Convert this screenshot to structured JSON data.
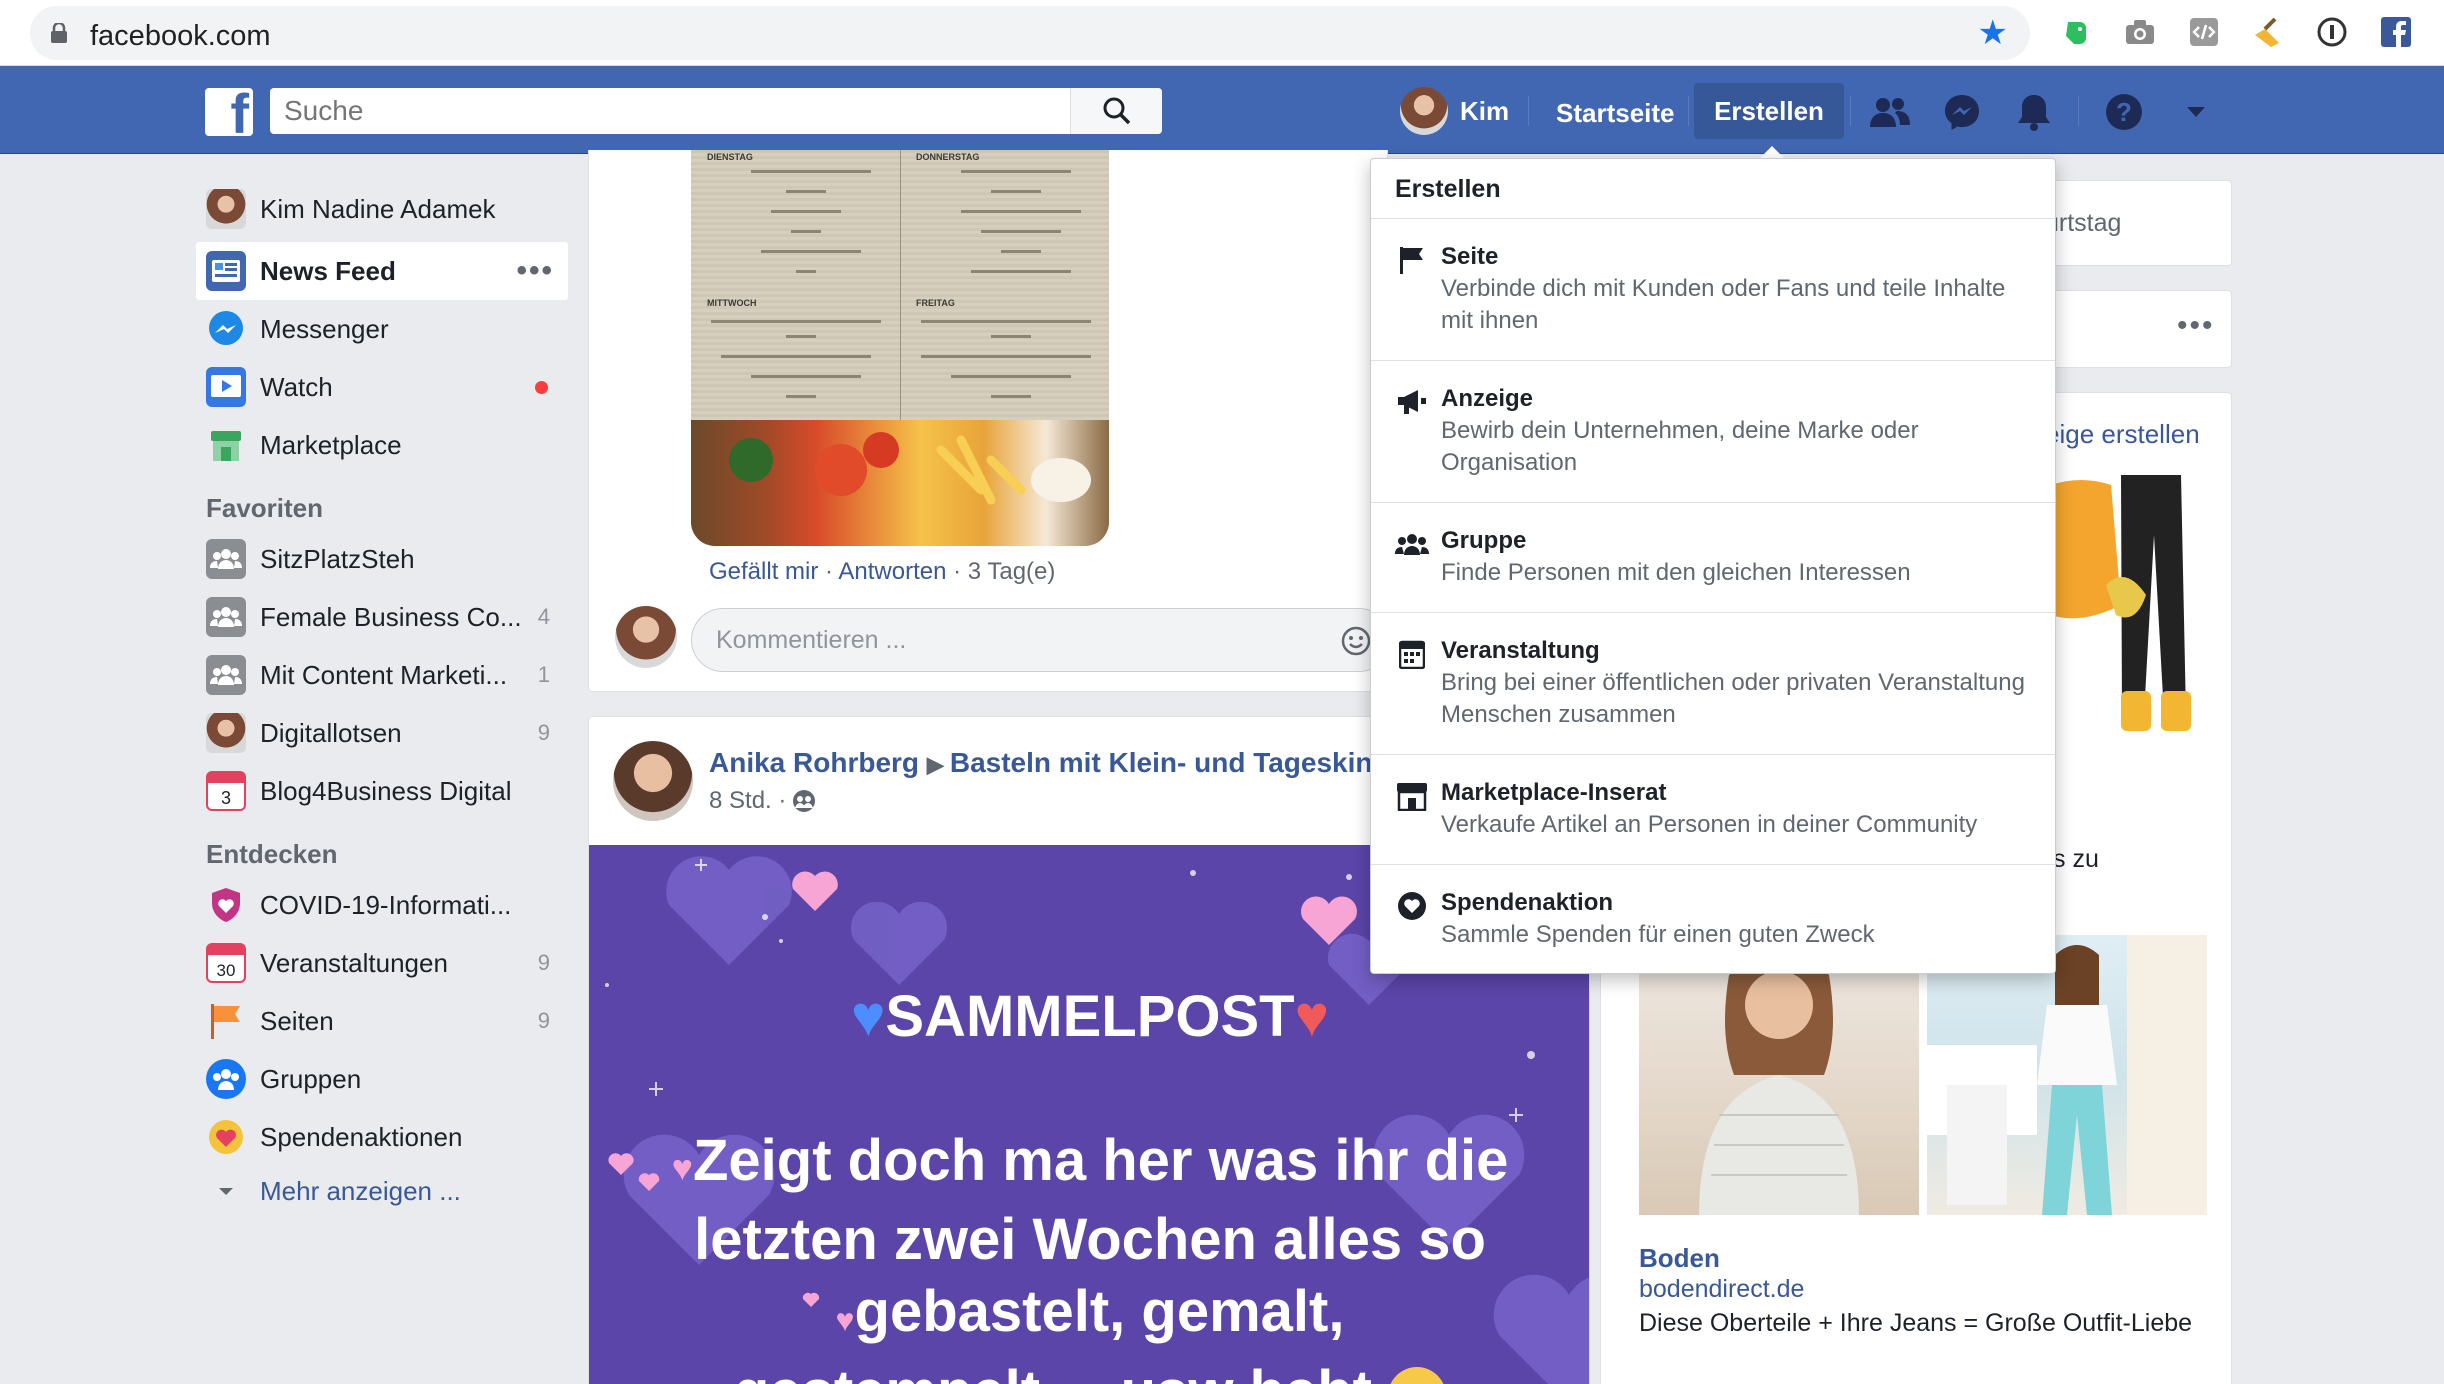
{
  "browser": {
    "url": "facebook.com"
  },
  "header": {
    "search_placeholder": "Suche",
    "user_name": "Kim",
    "home_label": "Startseite",
    "create_label": "Erstellen"
  },
  "sidebar": {
    "profile_name": "Kim Nadine Adamek",
    "main_items": [
      {
        "label": "News Feed"
      },
      {
        "label": "Messenger"
      },
      {
        "label": "Watch"
      },
      {
        "label": "Marketplace"
      }
    ],
    "favorites_heading": "Favoriten",
    "favorites": [
      {
        "label": "SitzPlatzSteh",
        "count": ""
      },
      {
        "label": "Female Business Co...",
        "count": "4"
      },
      {
        "label": "Mit Content Marketi...",
        "count": "1"
      },
      {
        "label": "Digitallotsen",
        "count": "9"
      },
      {
        "label": "Blog4Business Digital",
        "count": ""
      }
    ],
    "explore_heading": "Entdecken",
    "explore": [
      {
        "label": "COVID-19-Informati...",
        "count": ""
      },
      {
        "label": "Veranstaltungen",
        "count": "9"
      },
      {
        "label": "Seiten",
        "count": "9"
      },
      {
        "label": "Gruppen",
        "count": ""
      },
      {
        "label": "Spendenaktionen",
        "count": ""
      }
    ],
    "more_label": "Mehr anzeigen ..."
  },
  "comment": {
    "like": "Gefällt mir",
    "reply": "Antworten",
    "age": "3 Tag(e)",
    "input_placeholder": "Kommentieren ..."
  },
  "menu_image": {
    "days": [
      "DIENSTAG",
      "DONNERSTAG",
      "MITTWOCH",
      "FREITAG"
    ]
  },
  "post": {
    "author": "Anika Rohrberg",
    "group": "Basteln mit Klein- und Tageskinde",
    "time": "8 Std. ·",
    "title": "SAMMELPOST",
    "text_line1": "Zeigt doch ma her was ihr die",
    "text_line2": "letzten zwei Wochen alles so",
    "text_line3": "gebastelt, gemalt,",
    "text_line4": "gestempelt ... usw habt"
  },
  "right": {
    "birthday_partial": "urtstag",
    "ad_create_partial": "eige erstellen",
    "partial_text": "s zu",
    "ad_title": "Boden",
    "ad_domain": "bodendirect.de",
    "ad_text": "Diese Oberteile + Ihre Jeans = Große Outfit-Liebe"
  },
  "create_menu": {
    "title": "Erstellen",
    "items": [
      {
        "label": "Seite",
        "desc": "Verbinde dich mit Kunden oder Fans und teile Inhalte mit ihnen"
      },
      {
        "label": "Anzeige",
        "desc": "Bewirb dein Unternehmen, deine Marke oder Organisation"
      },
      {
        "label": "Gruppe",
        "desc": "Finde Personen mit den gleichen Interessen"
      },
      {
        "label": "Veranstaltung",
        "desc": "Bring bei einer öffentlichen oder privaten Veranstaltung Menschen zusammen"
      },
      {
        "label": "Marketplace-Inserat",
        "desc": "Verkaufe Artikel an Personen in deiner Community"
      },
      {
        "label": "Spendenaktion",
        "desc": "Sammle Spenden für einen guten Zweck"
      }
    ]
  },
  "colors": {
    "fb_blue": "#4267b2",
    "link": "#385898",
    "post_bg": "#5b45a8"
  }
}
